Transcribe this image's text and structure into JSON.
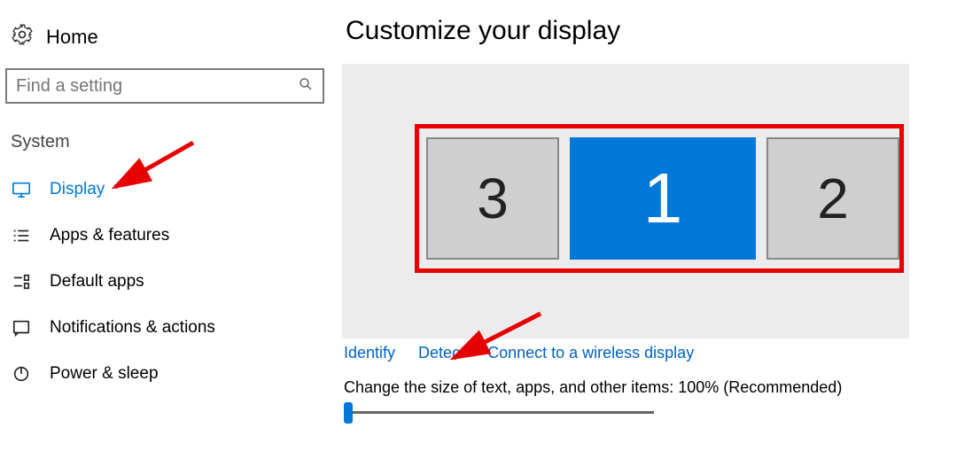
{
  "sidebar": {
    "home_label": "Home",
    "search_placeholder": "Find a setting",
    "section_title": "System",
    "items": [
      {
        "label": "Display",
        "active": true
      },
      {
        "label": "Apps & features"
      },
      {
        "label": "Default apps"
      },
      {
        "label": "Notifications & actions"
      },
      {
        "label": "Power & sleep"
      }
    ]
  },
  "main": {
    "title": "Customize your display",
    "monitors": {
      "left": "3",
      "center": "1",
      "right": "2",
      "selected": "1"
    },
    "links": {
      "identify": "Identify",
      "detect": "Detect",
      "connect_wireless": "Connect to a wireless display"
    },
    "scale_label": "Change the size of text, apps, and other items: 100% (Recommended)"
  },
  "annotations": {
    "arrow_to_display": true,
    "arrow_to_identify": true,
    "red_box_monitors": true
  }
}
